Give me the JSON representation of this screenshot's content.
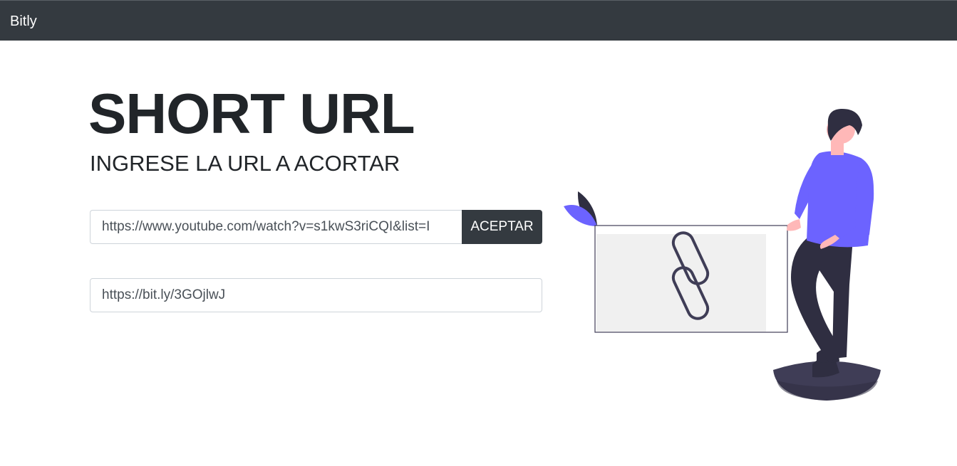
{
  "navbar": {
    "brand": "Bitly"
  },
  "main": {
    "title": "SHORT URL",
    "subtitle": "INGRESE LA URL A ACORTAR",
    "url_input": {
      "value": "https://www.youtube.com/watch?v=s1kwS3riCQI&list=I"
    },
    "accept_button": "ACEPTAR",
    "result_input": {
      "value": "https://bit.ly/3GOjlwJ"
    }
  },
  "colors": {
    "navbar_bg": "#343a40",
    "button_bg": "#343a40",
    "accent_purple": "#6c63ff",
    "dark_navy": "#2f2e41"
  },
  "illustration": {
    "icon": "link-chain-icon"
  }
}
